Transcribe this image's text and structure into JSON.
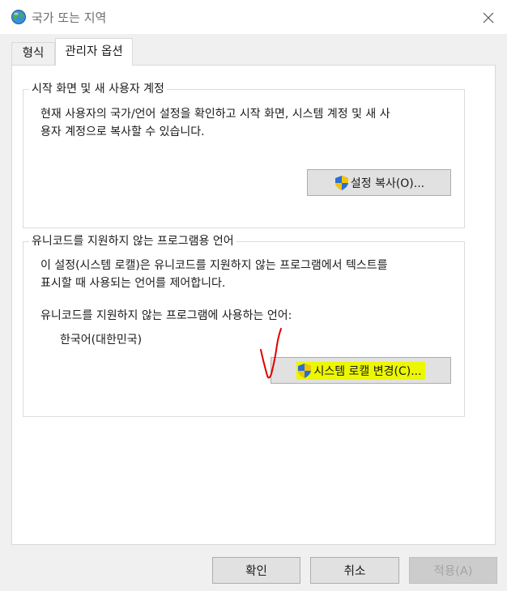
{
  "window": {
    "title": "국가 또는 지역",
    "icon": "globe-icon"
  },
  "tabs": [
    {
      "label": "형식",
      "active": false
    },
    {
      "label": "관리자 옵션",
      "active": true
    }
  ],
  "welcome_group": {
    "title": "시작 화면 및 새 사용자 계정",
    "description_line1": "현재 사용자의 국가/언어 설정을 확인하고 시작 화면, 시스템 계정 및 새 사",
    "description_line2": "용자 계정으로 복사할 수 있습니다.",
    "copy_button": "설정 복사(O)..."
  },
  "unicode_group": {
    "title": "유니코드를 지원하지 않는 프로그램용 언어",
    "description_line1": "이 설정(시스템 로캘)은 유니코드를 지원하지 않는 프로그램에서 텍스트를",
    "description_line2": "표시할 때 사용되는 언어를 제어합니다.",
    "current_label": "유니코드를 지원하지 않는 프로그램에 사용하는 언어:",
    "current_value": "한국어(대한민국)",
    "change_button": "시스템 로캘 변경(C)..."
  },
  "footer": {
    "ok": "확인",
    "cancel": "취소",
    "apply": "적용(A)"
  },
  "colors": {
    "highlight": "#ecf700",
    "annotation": "#e00000"
  }
}
